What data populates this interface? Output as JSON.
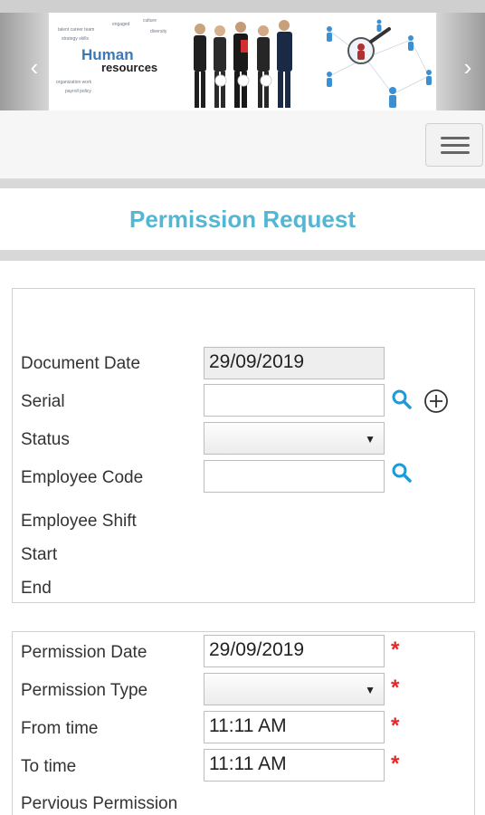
{
  "banner": {
    "caption_word1": "Human",
    "caption_word2": "resources",
    "prev_icon": "chevron-left-icon",
    "next_icon": "chevron-right-icon",
    "dots": 3
  },
  "nav": {
    "menu_icon": "hamburger-menu-icon"
  },
  "page": {
    "title": "Permission Request",
    "title_color": "#53b6d3"
  },
  "header_section": {
    "document_date_label": "Document Date",
    "document_date_value": "29/09/2019",
    "serial_label": "Serial",
    "serial_value": "",
    "status_label": "Status",
    "status_value": "",
    "employee_code_label": "Employee Code",
    "employee_code_value": "",
    "employee_shift_label": "Employee Shift",
    "start_label": "Start",
    "end_label": "End"
  },
  "permission_section": {
    "permission_date_label": "Permission Date",
    "permission_date_value": "29/09/2019",
    "permission_type_label": "Permission Type",
    "permission_type_value": "",
    "from_time_label": "From time",
    "from_time_value": "11:11 AM",
    "to_time_label": "To time",
    "to_time_value": "11:11 AM",
    "previous_permission_label": "Pervious Permission",
    "required_marker": "*",
    "required_color": "#e02a2a"
  }
}
